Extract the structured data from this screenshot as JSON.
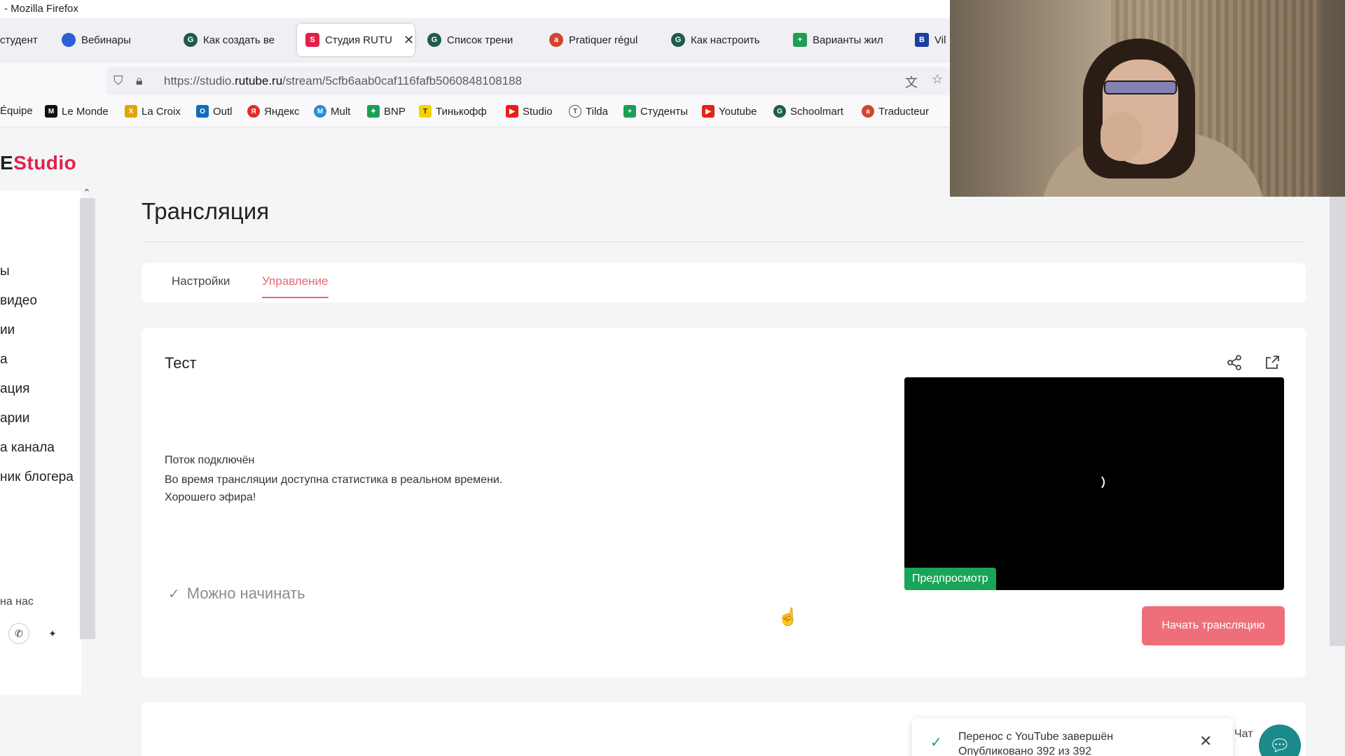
{
  "browser": {
    "window_title": "- Mozilla Firefox",
    "tabs": [
      {
        "label": "студент",
        "icon": "doc-icon",
        "color": "#888888"
      },
      {
        "label": "Вебинары",
        "icon": "flag-icon",
        "color": "#2a5fd6"
      },
      {
        "label": "Как создать ве",
        "icon": "gc-icon",
        "color": "#1f5c4a"
      },
      {
        "label": "Студия RUTU",
        "icon": "rutube-icon",
        "color": "#e3204b"
      },
      {
        "label": "Список трени",
        "icon": "gc-icon",
        "color": "#1f5c4a"
      },
      {
        "label": "Pratiquer régul",
        "icon": "mediapart-icon",
        "color": "#d4442e"
      },
      {
        "label": "Как настроить",
        "icon": "gc-icon",
        "color": "#1f5c4a"
      },
      {
        "label": "Варианты жил",
        "icon": "sheets-icon",
        "color": "#1e9e55"
      },
      {
        "label": "Vil",
        "icon": "b-icon",
        "color": "#1a3f9e"
      }
    ],
    "url_prefix": "https://studio.",
    "url_domain": "rutube.ru",
    "url_path": "/stream/5cfb6aab0caf116fafb5060848108188",
    "bookmarks": [
      {
        "label": "Équipe",
        "icon": "",
        "color": "#ffffff"
      },
      {
        "label": "Le Monde",
        "icon": "lemonde-icon",
        "color": "#111111"
      },
      {
        "label": "La Croix",
        "icon": "lacroix-icon",
        "color": "#e3a400"
      },
      {
        "label": "Outl",
        "icon": "outlook-icon",
        "color": "#0f6cbd"
      },
      {
        "label": "Яндекс",
        "icon": "yandex-icon",
        "color": "#e32a2a"
      },
      {
        "label": "Mult",
        "icon": "mult-icon",
        "color": "#2a8cd6"
      },
      {
        "label": "BNP",
        "icon": "bnp-icon",
        "color": "#1e9e55"
      },
      {
        "label": "Тинькофф",
        "icon": "tinkoff-icon",
        "color": "#f5d200"
      },
      {
        "label": "Studio",
        "icon": "youtube-icon",
        "color": "#e62117"
      },
      {
        "label": "Tilda",
        "icon": "tilda-icon",
        "color": "#555555"
      },
      {
        "label": "Студенты",
        "icon": "sheets-icon",
        "color": "#1e9e55"
      },
      {
        "label": "Youtube",
        "icon": "youtube-icon",
        "color": "#e62117"
      },
      {
        "label": "Schoolmart",
        "icon": "gc-icon",
        "color": "#1f5c4a"
      },
      {
        "label": "Traducteur",
        "icon": "mediapart-icon",
        "color": "#d4442e"
      }
    ]
  },
  "studio": {
    "logo_prefix": "E",
    "logo_text": "Studio",
    "sidebar_items": [
      "ы",
      "видео",
      "ии",
      "а",
      "ация",
      "арии",
      "а канала",
      "ник блогера"
    ],
    "follow_label": "на нас",
    "page_title": "Трансляция",
    "tabs": {
      "settings": "Настройки",
      "management": "Управление"
    },
    "card_title": "Тест",
    "stream_status": "Поток подключён",
    "stats_message": "Во время трансляции доступна статистика в реальном времени.",
    "wish_message": "Хорошего эфира!",
    "ready_label": "Можно начинать",
    "preview_badge": "Предпросмотр",
    "start_button": "Начать трансляцию",
    "toast_title": "Перенос с YouTube завершён",
    "toast_text": "Опубликовано 392 из 392",
    "chat_label": "Чат"
  },
  "colors": {
    "accent": "#e3204b",
    "start_button": "#ee6f7a",
    "preview_badge": "#18a558",
    "active_tab": "#e36b75"
  }
}
